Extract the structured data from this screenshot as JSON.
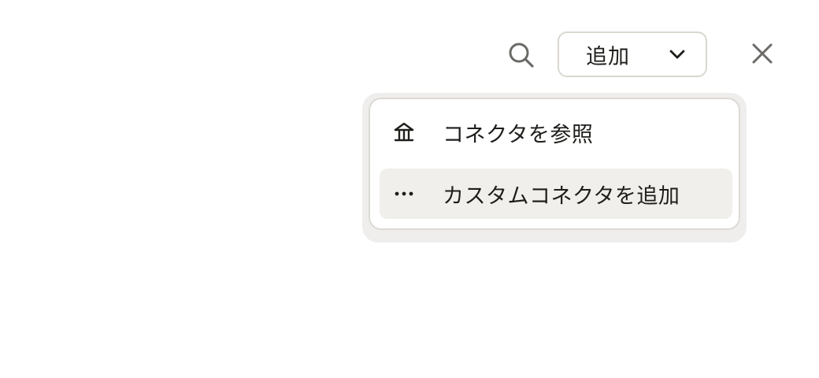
{
  "toolbar": {
    "search_icon": "search-icon",
    "add_select": {
      "label": "追加",
      "icon": "chevron-down-icon"
    },
    "close_icon": "close-icon"
  },
  "menu": {
    "items": [
      {
        "label": "コネクタを参照",
        "icon": "institution-icon"
      },
      {
        "label": "カスタムコネクタを追加",
        "icon": "ellipsis-icon",
        "highlighted": true
      }
    ]
  },
  "colors": {
    "text": "#1f1e1b",
    "border": "#d9d7d0",
    "highlight": "#f0efeb",
    "icon_gray": "#6b6a66"
  }
}
